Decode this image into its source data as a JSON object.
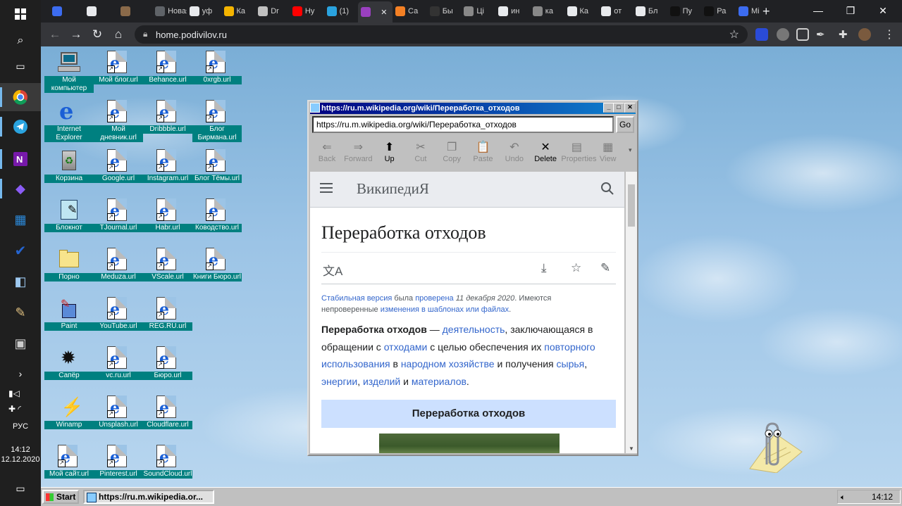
{
  "taskbar_left": {
    "lang": "РУС",
    "time": "14:12",
    "date": "12.12.2020"
  },
  "chrome": {
    "tabs": [
      {
        "label": "",
        "color": "#3c6cf0"
      },
      {
        "label": "",
        "color": "#e8eaed"
      },
      {
        "label": "",
        "color": "#8a6a4a"
      },
      {
        "label": "Новая",
        "color": "#5f6368"
      },
      {
        "label": "уф",
        "color": "#e8eaed"
      },
      {
        "label": "Ка",
        "color": "#f4b400"
      },
      {
        "label": "Dr",
        "color": "#c0c0c0"
      },
      {
        "label": "Ну",
        "color": "#ff0000"
      },
      {
        "label": "(1)",
        "color": "#2aa3df"
      },
      {
        "label": "",
        "color": "#9a40c0"
      },
      {
        "label": "Са",
        "color": "#f48024"
      },
      {
        "label": "Бы",
        "color": "#333333"
      },
      {
        "label": "Ці",
        "color": "#888888"
      },
      {
        "label": "ин",
        "color": "#e8eaed"
      },
      {
        "label": "ка",
        "color": "#888888"
      },
      {
        "label": "Ка",
        "color": "#e8eaed"
      },
      {
        "label": "от",
        "color": "#e8eaed"
      },
      {
        "label": "Бл",
        "color": "#e8eaed"
      },
      {
        "label": "Пу",
        "color": "#111111"
      },
      {
        "label": "Ра",
        "color": "#111111"
      },
      {
        "label": "Mi",
        "color": "#3c6cf0"
      }
    ],
    "new_tab": "+",
    "url": "home.podivilov.ru"
  },
  "desktop": {
    "icons": [
      {
        "label": "Мой компьютер",
        "kind": "computer"
      },
      {
        "label": "Мой блог.url",
        "kind": "ie-link"
      },
      {
        "label": "Behance.url",
        "kind": "ie-link"
      },
      {
        "label": "0xrgb.url",
        "kind": "ie-link"
      },
      {
        "label": "Internet Explorer",
        "kind": "ie"
      },
      {
        "label": "Мой дневник.url",
        "kind": "ie-link"
      },
      {
        "label": "Dribbble.url",
        "kind": "ie-link"
      },
      {
        "label": "Блог Бирмана.url",
        "kind": "ie-link"
      },
      {
        "label": "Корзина",
        "kind": "recycle"
      },
      {
        "label": "Google.url",
        "kind": "ie-link"
      },
      {
        "label": "Instagram.url",
        "kind": "ie-link"
      },
      {
        "label": "Блог Тёмы.url",
        "kind": "ie-link"
      },
      {
        "label": "Блокнот",
        "kind": "notepad"
      },
      {
        "label": "TJournal.url",
        "kind": "ie-link"
      },
      {
        "label": "Habr.url",
        "kind": "ie-link"
      },
      {
        "label": "Ководство.url",
        "kind": "ie-link"
      },
      {
        "label": "Порно",
        "kind": "folder"
      },
      {
        "label": "Meduza.url",
        "kind": "ie-link"
      },
      {
        "label": "VScale.url",
        "kind": "ie-link"
      },
      {
        "label": "Книги Бюро.url",
        "kind": "ie-link"
      },
      {
        "label": "Paint",
        "kind": "paint"
      },
      {
        "label": "YouTube.url",
        "kind": "ie-link"
      },
      {
        "label": "REG.RU.url",
        "kind": "ie-link"
      },
      {
        "label": "",
        "kind": "none"
      },
      {
        "label": "Сапёр",
        "kind": "mine"
      },
      {
        "label": "vc.ru.url",
        "kind": "ie-link"
      },
      {
        "label": "Бюро.url",
        "kind": "ie-link"
      },
      {
        "label": "",
        "kind": "none"
      },
      {
        "label": "Winamp",
        "kind": "winamp"
      },
      {
        "label": "Unsplash.url",
        "kind": "ie-link"
      },
      {
        "label": "Cloudflare.url",
        "kind": "ie-link"
      },
      {
        "label": "",
        "kind": "none"
      },
      {
        "label": "Мой сайт.url",
        "kind": "ie-link"
      },
      {
        "label": "Pinterest.url",
        "kind": "ie-link"
      },
      {
        "label": "SoundCloud.url",
        "kind": "ie-link"
      },
      {
        "label": "",
        "kind": "none"
      }
    ]
  },
  "popup": {
    "title": "https://ru.m.wikipedia.org/wiki/Переработка_отходов",
    "address": "https://ru.m.wikipedia.org/wiki/Переработка_отходов",
    "go": "Go",
    "toolbar": [
      {
        "label": "Back",
        "icon": "⇐",
        "enabled": false
      },
      {
        "label": "Forward",
        "icon": "⇒",
        "enabled": false
      },
      {
        "label": "Up",
        "icon": "⬆",
        "enabled": true
      },
      {
        "label": "Cut",
        "icon": "✂",
        "enabled": false
      },
      {
        "label": "Copy",
        "icon": "❐",
        "enabled": false
      },
      {
        "label": "Paste",
        "icon": "📋",
        "enabled": false
      },
      {
        "label": "Undo",
        "icon": "↶",
        "enabled": false
      },
      {
        "label": "Delete",
        "icon": "✕",
        "enabled": true
      },
      {
        "label": "Properties",
        "icon": "▤",
        "enabled": false
      },
      {
        "label": "View",
        "icon": "▦",
        "enabled": false
      }
    ]
  },
  "wiki": {
    "logo": "ВикипедиЯ",
    "title": "Переработка отходов",
    "notice": {
      "stable": "Стабильная версия",
      "t1": " была ",
      "checked": "проверена",
      "date": " 11 декабря 2020",
      "t2": ". Имеются непроверенные ",
      "changes": "изменения в шаблонах или файлах",
      "t3": "."
    },
    "body": {
      "term": "Переработка отходов",
      "s1": " — ",
      "l1": "деятельность",
      "s2": ", заключающаяся в обращении с ",
      "l2": "отходами",
      "s3": " с целью обеспечения их ",
      "l3": "повторного использования",
      "s4": " в ",
      "l4": "народном хозяйстве",
      "s5": " и получения ",
      "l5": "сырья",
      "s6": ", ",
      "l6": "энергии",
      "s7": ", ",
      "l7": "изделий",
      "s8": " и ",
      "l8": "материалов",
      "s9": "."
    },
    "infobox_title": "Переработка отходов"
  },
  "w98taskbar": {
    "start": "Start",
    "task": "https://ru.m.wikipedia.or...",
    "time": "14:12"
  }
}
